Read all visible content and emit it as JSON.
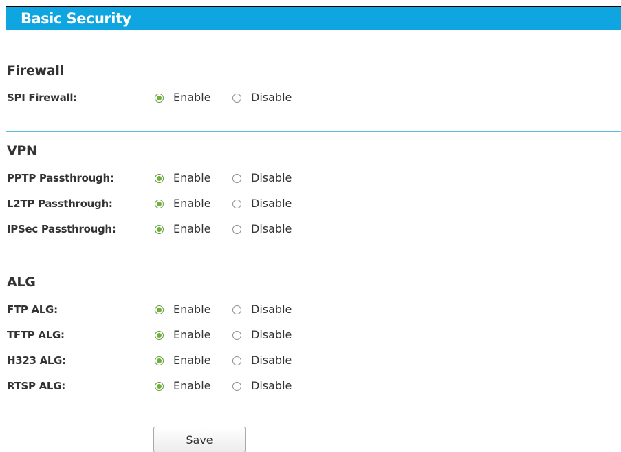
{
  "header": {
    "title": "Basic Security"
  },
  "sections": [
    {
      "title": "Firewall",
      "rows": [
        {
          "label": "SPI Firewall:",
          "enable_label": "Enable",
          "disable_label": "Disable",
          "selected": "Enable"
        }
      ]
    },
    {
      "title": "VPN",
      "rows": [
        {
          "label": "PPTP Passthrough:",
          "enable_label": "Enable",
          "disable_label": "Disable",
          "selected": "Enable"
        },
        {
          "label": "L2TP Passthrough:",
          "enable_label": "Enable",
          "disable_label": "Disable",
          "selected": "Enable"
        },
        {
          "label": "IPSec Passthrough:",
          "enable_label": "Enable",
          "disable_label": "Disable",
          "selected": "Enable"
        }
      ]
    },
    {
      "title": "ALG",
      "rows": [
        {
          "label": "FTP ALG:",
          "enable_label": "Enable",
          "disable_label": "Disable",
          "selected": "Enable"
        },
        {
          "label": "TFTP ALG:",
          "enable_label": "Enable",
          "disable_label": "Disable",
          "selected": "Enable"
        },
        {
          "label": "H323 ALG:",
          "enable_label": "Enable",
          "disable_label": "Disable",
          "selected": "Enable"
        },
        {
          "label": "RTSP ALG:",
          "enable_label": "Enable",
          "disable_label": "Disable",
          "selected": "Enable"
        }
      ]
    }
  ],
  "actions": {
    "save_label": "Save"
  },
  "colors": {
    "header_bar": "#0ea5e0",
    "divider": "#5bbfe3",
    "radio_selected": "#6cb23a"
  }
}
